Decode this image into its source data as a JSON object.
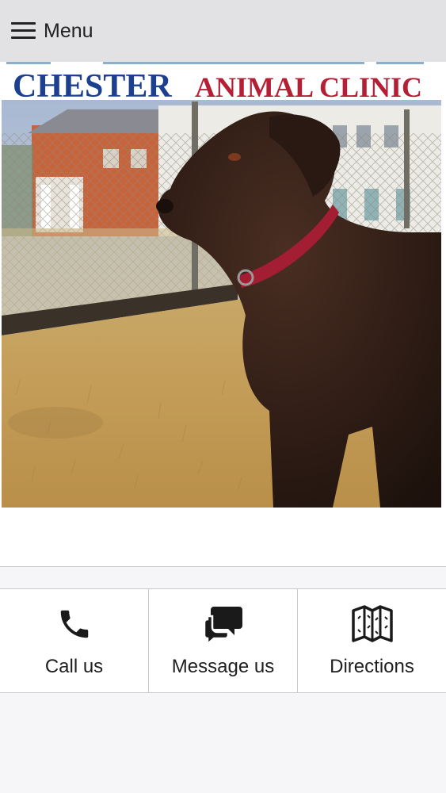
{
  "topbar": {
    "menu_label": "Menu",
    "menu_icon": "hamburger-icon"
  },
  "hero": {
    "logo_text_left": "CHESTER",
    "logo_text_right": "ANIMAL CLINIC",
    "colors": {
      "logo_blue": "#1d3f8f",
      "logo_red": "#b51f35"
    },
    "subject": "dog-photo"
  },
  "actions": [
    {
      "label": "Call us",
      "icon": "phone-icon"
    },
    {
      "label": "Message us",
      "icon": "chat-bubbles-icon"
    },
    {
      "label": "Directions",
      "icon": "map-icon"
    }
  ]
}
